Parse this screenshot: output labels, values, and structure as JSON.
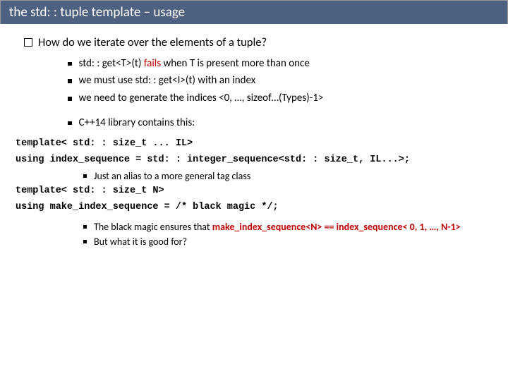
{
  "title": "the std: : tuple template – usage",
  "question": "How do we iterate over the elements of a tuple?",
  "bul_a": {
    "p1": "std: : get<T>(t) ",
    "p2": "fails ",
    "p3": "when T is present more than once"
  },
  "bul_b": "we must use std: : get<I>(t) with an index",
  "bul_c": "we need to generate the indices <0, …, sizeof…(Types)-1>",
  "bul_d": "C++14 library contains this:",
  "code1": "template< std: : size_t ... IL>",
  "code2": "using index_sequence = std: : integer_sequence<std: : size_t, IL...>;",
  "bul_e": "Just an alias to a more general tag class",
  "code3": "template< std: : size_t N>",
  "code4": "using make_index_sequence = /* black magic */;",
  "bul_f": {
    "p1": "The black magic ensures that ",
    "p2": "make_index_sequence<N> == index_sequence< 0, 1, …, N-1>"
  },
  "bul_g": "But what it is good for?"
}
